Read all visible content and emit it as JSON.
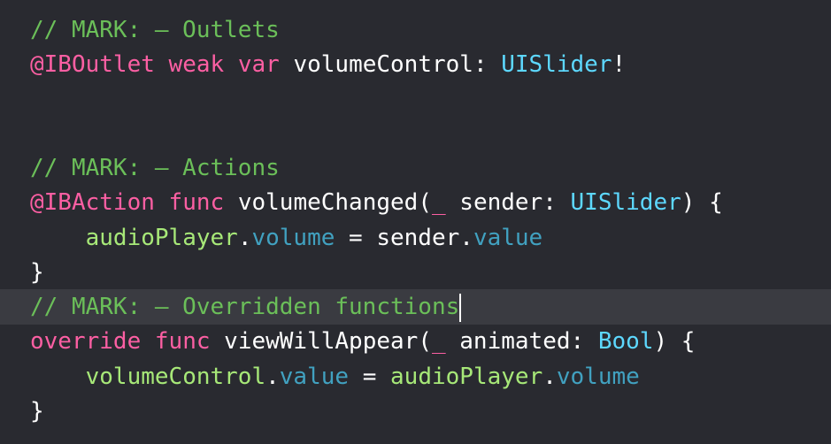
{
  "editor": {
    "lines": [
      {
        "tokens": [
          {
            "text": "// MARK: — Outlets",
            "type": "comment"
          }
        ]
      },
      {
        "tokens": [
          {
            "text": "@IBOutlet",
            "type": "keyword"
          },
          {
            "text": " ",
            "type": "plain"
          },
          {
            "text": "weak",
            "type": "keyword"
          },
          {
            "text": " ",
            "type": "plain"
          },
          {
            "text": "var",
            "type": "keyword"
          },
          {
            "text": " volumeControl: ",
            "type": "plain"
          },
          {
            "text": "UISlider",
            "type": "type"
          },
          {
            "text": "!",
            "type": "plain"
          }
        ]
      },
      {
        "tokens": []
      },
      {
        "tokens": []
      },
      {
        "tokens": [
          {
            "text": "// MARK: — Actions",
            "type": "comment"
          }
        ]
      },
      {
        "tokens": [
          {
            "text": "@IBAction",
            "type": "keyword"
          },
          {
            "text": " ",
            "type": "plain"
          },
          {
            "text": "func",
            "type": "keyword"
          },
          {
            "text": " volumeChanged(",
            "type": "plain"
          },
          {
            "text": "_",
            "type": "keyword"
          },
          {
            "text": " sender: ",
            "type": "plain"
          },
          {
            "text": "UISlider",
            "type": "type"
          },
          {
            "text": ") {",
            "type": "plain"
          }
        ]
      },
      {
        "tokens": [
          {
            "text": "    ",
            "type": "plain"
          },
          {
            "text": "audioPlayer",
            "type": "prop"
          },
          {
            "text": ".",
            "type": "plain"
          },
          {
            "text": "volume",
            "type": "member"
          },
          {
            "text": " = sender.",
            "type": "plain"
          },
          {
            "text": "value",
            "type": "member"
          }
        ]
      },
      {
        "tokens": [
          {
            "text": "}",
            "type": "plain"
          }
        ]
      },
      {
        "current": true,
        "tokens": [
          {
            "text": "// MARK: — Overridden functions",
            "type": "comment"
          }
        ]
      },
      {
        "tokens": [
          {
            "text": "override",
            "type": "keyword"
          },
          {
            "text": " ",
            "type": "plain"
          },
          {
            "text": "func",
            "type": "keyword"
          },
          {
            "text": " viewWillAppear(",
            "type": "plain"
          },
          {
            "text": "_",
            "type": "keyword"
          },
          {
            "text": " animated: ",
            "type": "plain"
          },
          {
            "text": "Bool",
            "type": "type"
          },
          {
            "text": ") {",
            "type": "plain"
          }
        ]
      },
      {
        "tokens": [
          {
            "text": "    ",
            "type": "plain"
          },
          {
            "text": "volumeControl",
            "type": "prop"
          },
          {
            "text": ".",
            "type": "plain"
          },
          {
            "text": "value",
            "type": "member"
          },
          {
            "text": " = ",
            "type": "plain"
          },
          {
            "text": "audioPlayer",
            "type": "prop"
          },
          {
            "text": ".",
            "type": "plain"
          },
          {
            "text": "volume",
            "type": "member"
          }
        ]
      },
      {
        "tokens": [
          {
            "text": "}",
            "type": "plain"
          }
        ]
      }
    ]
  },
  "colors": {
    "background": "#292A30",
    "current_line": "#3A3B41",
    "comment": "#6BBF59",
    "keyword": "#FC5FA3",
    "type": "#5DD8FF",
    "prop": "#A7E878",
    "member": "#41A1C0",
    "plain": "#FFFFFF"
  }
}
